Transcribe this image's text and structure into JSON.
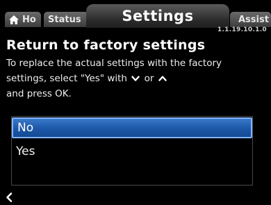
{
  "tabs": {
    "home_label": "Ho",
    "status_label": "Status",
    "active_label": "Settings",
    "assist_label": "Assist"
  },
  "version": "1.1.19.10.1.0",
  "page": {
    "title": "Return to factory settings",
    "description_part1": "To replace the actual settings with the factory settings, select \"Yes\" with",
    "description_or": "or",
    "description_part2": "and press OK."
  },
  "options": [
    {
      "label": "No",
      "selected": true
    },
    {
      "label": "Yes",
      "selected": false
    }
  ],
  "icons": {
    "home": "home-icon",
    "down": "chevron-down-icon",
    "up": "chevron-up-icon",
    "back": "chevron-left-icon"
  },
  "colors": {
    "selection": "#1c57a8",
    "selection_border": "#7fb4ff",
    "background": "#000000"
  }
}
